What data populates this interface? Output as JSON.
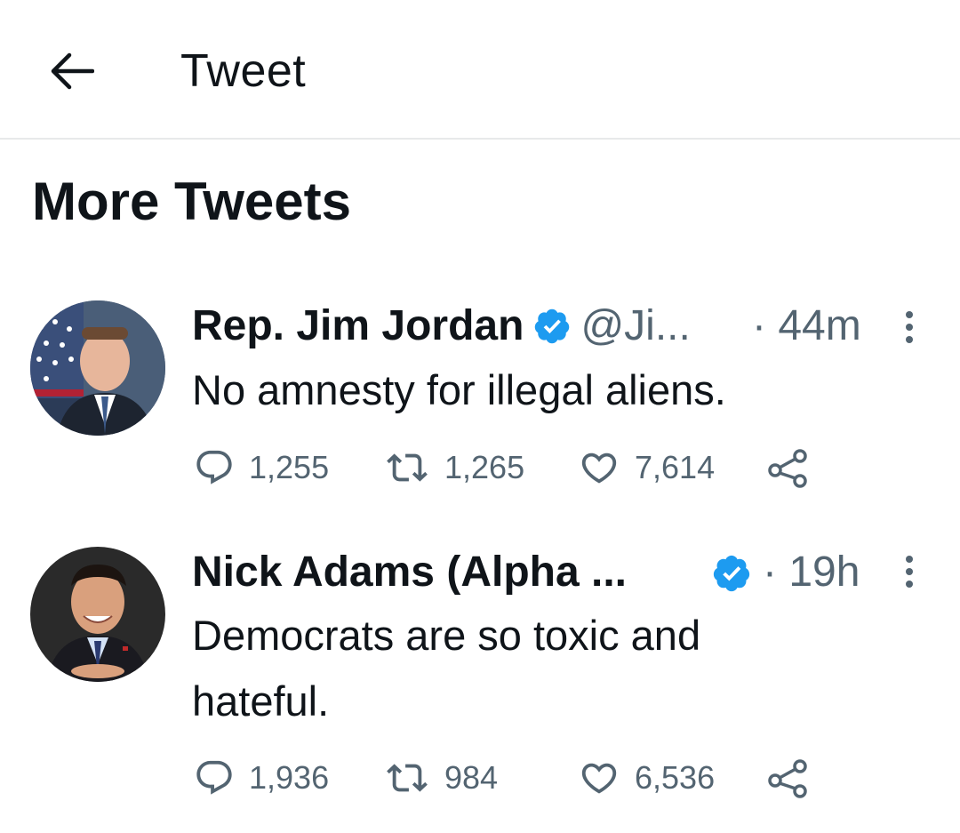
{
  "header": {
    "title": "Tweet",
    "back_icon": "arrow-left-icon"
  },
  "section": {
    "title": "More Tweets"
  },
  "tweets": [
    {
      "display_name": "Rep. Jim Jordan",
      "verified": true,
      "handle": "@Ji...",
      "time": "· 44m",
      "text": "No amnesty for illegal aliens.",
      "replies": "1,255",
      "retweets": "1,265",
      "likes": "7,614"
    },
    {
      "display_name": "Nick Adams (Alpha ...",
      "verified": true,
      "handle": "",
      "time": "· 19h",
      "text": "Democrats are so toxic and hateful.",
      "replies": "1,936",
      "retweets": "984",
      "likes": "6,536"
    }
  ],
  "colors": {
    "text_primary": "#0f1419",
    "text_secondary": "#536471",
    "verified_blue": "#1d9bf0",
    "divider": "#e7e9ea"
  }
}
